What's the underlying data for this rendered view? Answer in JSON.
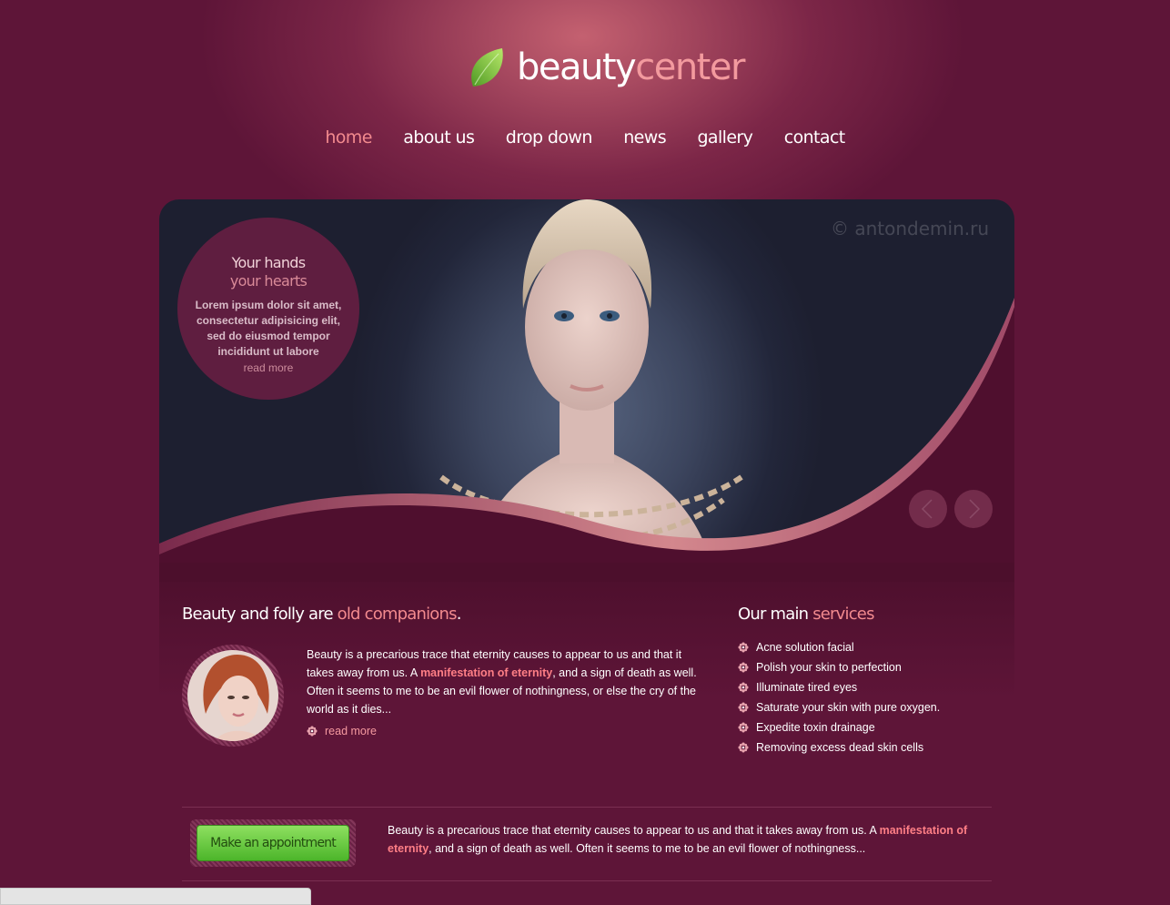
{
  "logo": {
    "word1": "beauty",
    "word2": "center",
    "icon": "leaf-icon"
  },
  "nav": {
    "items": [
      {
        "label": "home",
        "active": true
      },
      {
        "label": "about us",
        "active": false
      },
      {
        "label": "drop down",
        "active": false
      },
      {
        "label": "news",
        "active": false
      },
      {
        "label": "gallery",
        "active": false
      },
      {
        "label": "contact",
        "active": false
      }
    ]
  },
  "slider": {
    "watermark": "© antondemin.ru",
    "caption": {
      "line1": "Your hands",
      "line2": "your hearts",
      "text": "Lorem ipsum dolor sit amet, consectetur adipisicing elit, sed do eiusmod tempor incididunt ut labore",
      "read_more": "read more"
    },
    "prev_icon": "chevron-left-icon",
    "next_icon": "chevron-right-icon"
  },
  "intro": {
    "heading_plain": "Beauty and folly are ",
    "heading_highlight": "old companions",
    "heading_end": ".",
    "text_before": "Beauty is a precarious trace that eternity causes to appear to us and that it takes away from us. A ",
    "text_highlight": "manifestation of eternity",
    "text_after": ", and a sign of death as well. Often it seems to me to be an evil flower of nothingness, or else the cry of the world as it dies...",
    "read_more": "read more"
  },
  "services": {
    "heading_plain": "Our main ",
    "heading_highlight": "services",
    "items": [
      "Acne solution facial",
      "Polish your skin to perfection",
      "Illuminate tired eyes",
      "Saturate your skin with pure oxygen.",
      "Expedite toxin drainage",
      "Removing excess dead skin cells"
    ]
  },
  "appointment": {
    "button_label": "Make an appointment",
    "text_before": "Beauty is a precarious trace that eternity causes to appear to us and that it takes away from us. A ",
    "text_highlight": "manifestation of eternity",
    "text_after": ", and a sign of death as well. Often it seems to me to be an evil flower of nothingness..."
  },
  "colors": {
    "background": "#5e1538",
    "accent": "#f28a8e",
    "button_green": "#6cc944"
  }
}
